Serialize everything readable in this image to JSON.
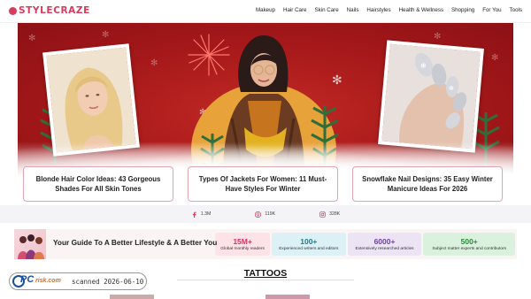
{
  "brand": {
    "name": "STYLECRAZE",
    "color": "#d53c5e"
  },
  "nav": {
    "items": [
      "Makeup",
      "Hair Care",
      "Skin Care",
      "Nails",
      "Hairstyles",
      "Health & Wellness",
      "Shopping",
      "For You",
      "Tools"
    ]
  },
  "hero": {
    "background_color": "#b01e1e",
    "cards": [
      {
        "title": "Blonde Hair Color Ideas: 43 Gorgeous Shades For All Skin Tones"
      },
      {
        "title": "Types Of Jackets For Women: 11 Must-Have Styles For Winter"
      },
      {
        "title": "Snowflake Nail Designs: 35 Easy Winter Manicure Ideas For 2026"
      }
    ]
  },
  "social": [
    {
      "icon": "facebook-icon",
      "count": "1.3M",
      "color": "#d53c5e"
    },
    {
      "icon": "pinterest-icon",
      "count": "119K",
      "color": "#d53c5e"
    },
    {
      "icon": "instagram-icon",
      "count": "328K",
      "color": "#d53c5e"
    }
  ],
  "stats": {
    "title": "Your Guide To A Better Lifestyle & A Better You",
    "items": [
      {
        "value": "15M+",
        "label": "Global monthly readers"
      },
      {
        "value": "100+",
        "label": "Experienced writers and editors"
      },
      {
        "value": "6000+",
        "label": "Extensively researched articles"
      },
      {
        "value": "500+",
        "label": "Subject matter experts and contributors"
      }
    ]
  },
  "section": {
    "title": "TATTOOS"
  },
  "stamp": {
    "logo_pc": "PC",
    "logo_risk": "risk.com",
    "text": "scanned 2026-06-10"
  }
}
